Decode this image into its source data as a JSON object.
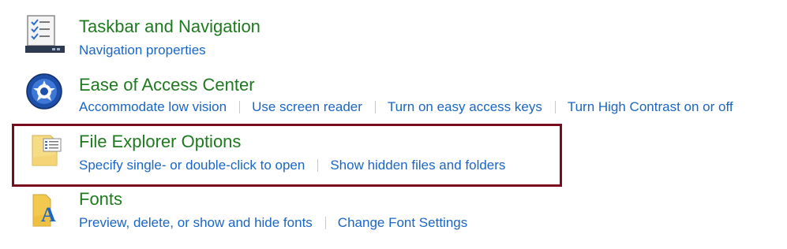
{
  "categories": [
    {
      "title": "Taskbar and Navigation",
      "icon": "taskbar-icon",
      "links": [
        "Navigation properties"
      ]
    },
    {
      "title": "Ease of Access Center",
      "icon": "ease-of-access-icon",
      "links": [
        "Accommodate low vision",
        "Use screen reader",
        "Turn on easy access keys",
        "Turn High Contrast on or off"
      ]
    },
    {
      "title": "File Explorer Options",
      "icon": "folder-options-icon",
      "links": [
        "Specify single- or double-click to open",
        "Show hidden files and folders"
      ]
    },
    {
      "title": "Fonts",
      "icon": "fonts-icon",
      "links": [
        "Preview, delete, or show and hide fonts",
        "Change Font Settings"
      ]
    }
  ],
  "colors": {
    "title_green": "#1e7a1e",
    "link_blue": "#1a66c5",
    "highlight_border": "#7a0a1e"
  }
}
